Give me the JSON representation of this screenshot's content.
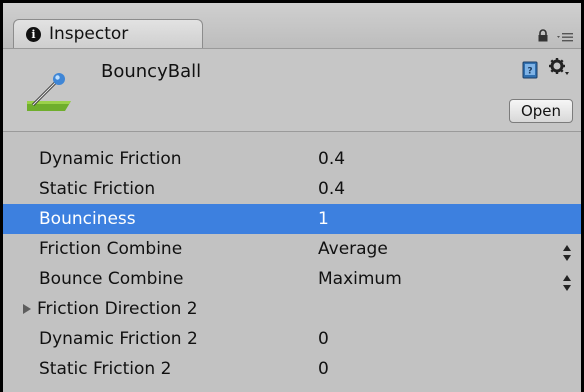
{
  "tab": {
    "title": "Inspector",
    "info_icon": "i"
  },
  "header": {
    "asset_name": "BouncyBall",
    "open_label": "Open"
  },
  "icons": {
    "info": "info-icon",
    "lock": "lock-icon",
    "menu": "tab-menu-icon",
    "asset": "physic-material-icon",
    "help": "help-book-icon",
    "gear": "gear-icon",
    "stepper": "stepper-arrows-icon",
    "foldout": "foldout-triangle-icon"
  },
  "colors": {
    "selection": "#3d80df",
    "background": "#c2c2c2"
  },
  "properties": [
    {
      "label": "Dynamic Friction",
      "value": "0.4"
    },
    {
      "label": "Static Friction",
      "value": "0.4"
    },
    {
      "label": "Bounciness",
      "value": "1"
    },
    {
      "label": "Friction Combine",
      "value": "Average"
    },
    {
      "label": "Bounce Combine",
      "value": "Maximum"
    },
    {
      "label": "Friction Direction 2",
      "value": ""
    },
    {
      "label": "Dynamic Friction 2",
      "value": "0"
    },
    {
      "label": "Static Friction 2",
      "value": "0"
    }
  ]
}
